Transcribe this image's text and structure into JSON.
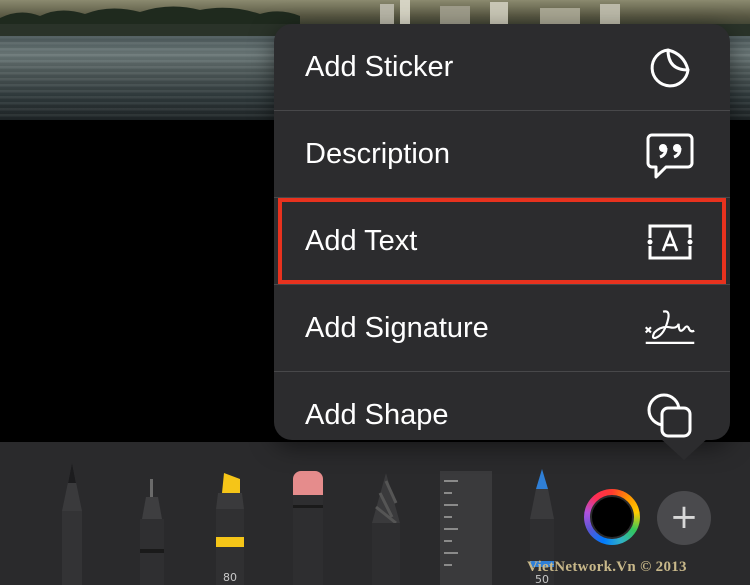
{
  "menu": {
    "items": [
      {
        "label": "Add Sticker",
        "icon": "sticker-icon"
      },
      {
        "label": "Description",
        "icon": "speech-bubble-quote-icon"
      },
      {
        "label": "Add Text",
        "icon": "text-box-icon"
      },
      {
        "label": "Add Signature",
        "icon": "signature-icon"
      },
      {
        "label": "Add Shape",
        "icon": "shapes-icon"
      }
    ],
    "highlighted_item": "Add Text",
    "highlight_color": "#e8321e"
  },
  "toolbar": {
    "tools": [
      {
        "name": "pen",
        "icon": "pen-icon"
      },
      {
        "name": "fineliner",
        "icon": "fineliner-icon"
      },
      {
        "name": "highlighter",
        "icon": "highlighter-icon",
        "number": "80",
        "color": "#f5c518"
      },
      {
        "name": "eraser",
        "icon": "eraser-icon"
      },
      {
        "name": "pencil",
        "icon": "pencil-icon"
      },
      {
        "name": "ruler",
        "icon": "ruler-icon"
      },
      {
        "name": "crayon",
        "icon": "crayon-icon",
        "number": "50",
        "color": "#2f7fd6"
      }
    ],
    "color_picker": "color-wheel-icon",
    "add_button": "+"
  },
  "watermark": "VietNetwork.Vn © 2013"
}
